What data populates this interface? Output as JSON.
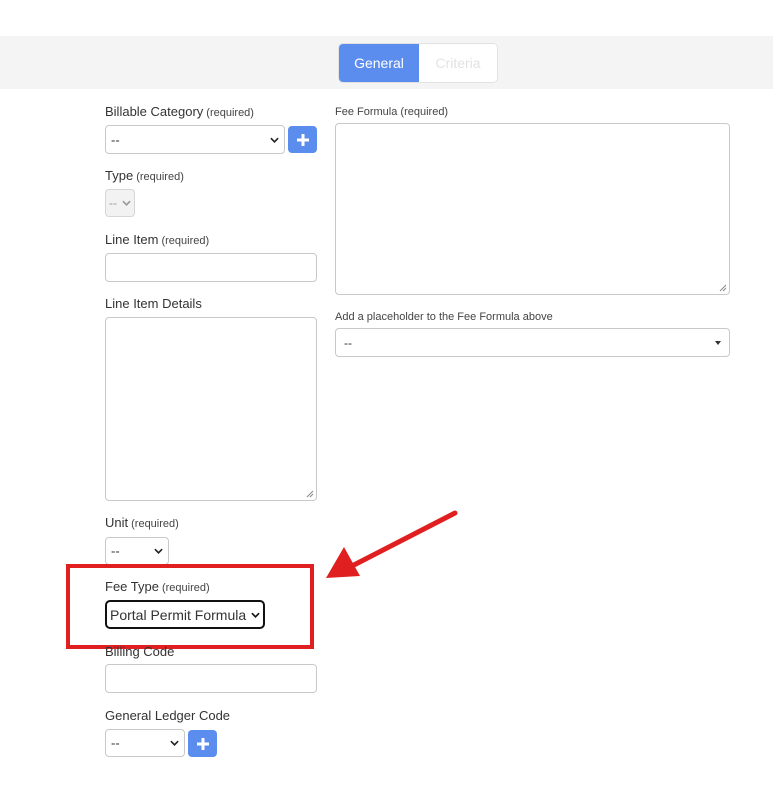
{
  "tabs": [
    {
      "label": "General",
      "active": true
    },
    {
      "label": "Criteria",
      "active": false
    }
  ],
  "form": {
    "billable_category": {
      "label": "Billable Category",
      "required": "(required)",
      "value": "--"
    },
    "type": {
      "label": "Type",
      "required": "(required)",
      "value": "--"
    },
    "line_item": {
      "label": "Line Item",
      "required": "(required)",
      "value": ""
    },
    "line_item_details": {
      "label": "Line Item Details",
      "value": ""
    },
    "unit": {
      "label": "Unit",
      "required": "(required)",
      "value": "--"
    },
    "fee_type": {
      "label": "Fee Type",
      "required": "(required)",
      "value": "Portal Permit Formula"
    },
    "billing_code": {
      "label": "Billing Code",
      "value": ""
    },
    "general_ledger_code": {
      "label": "General Ledger Code",
      "value": "--"
    },
    "fee_formula": {
      "label": "Fee Formula (required)",
      "value": ""
    },
    "placeholder": {
      "label": "Add a placeholder to the Fee Formula above",
      "value": "--"
    }
  },
  "colors": {
    "accent": "#5b8dee",
    "highlight": "#e02020",
    "tabbar_bg": "#f4f4f4"
  },
  "icons": {
    "add": "plus-icon",
    "dropdown": "chevron-down-icon",
    "annotation": "arrow-icon"
  }
}
